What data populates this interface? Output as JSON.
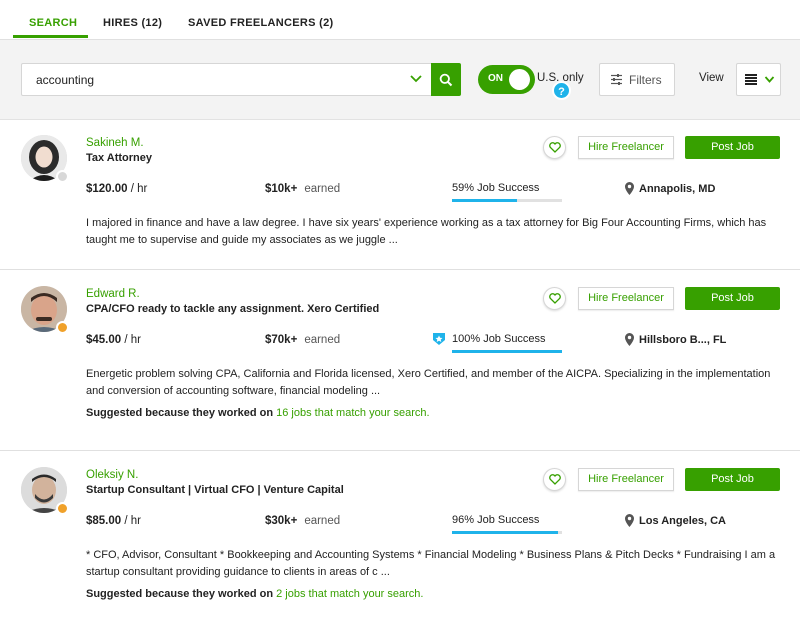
{
  "tabs": [
    {
      "label": "SEARCH",
      "active": true
    },
    {
      "label": "HIRES (12)",
      "active": false
    },
    {
      "label": "SAVED FREELANCERS (2)",
      "active": false
    }
  ],
  "search": {
    "value": "accounting",
    "us_toggle": "ON",
    "us_only_label": "U.S. only",
    "help_label": "?",
    "filters_label": "Filters",
    "view_label": "View"
  },
  "colors": {
    "accent_green": "#37a000",
    "job_success_blue": "#1fb3ea",
    "status_offline": "#d8d8d8",
    "status_away": "#f0a12a"
  },
  "actions": {
    "hire_label": "Hire Freelancer",
    "post_label": "Post Job"
  },
  "freelancers": [
    {
      "name": "Sakineh M.",
      "title": "Tax Attorney",
      "rate": "$120.00",
      "rate_unit": " / hr",
      "earned": "$10k+",
      "earned_label": "earned",
      "job_success": "59% Job Success",
      "job_success_pct": 59,
      "location": "Annapolis, MD",
      "description": "I majored in finance and have a law degree. I have six years' experience working as a tax attorney for Big Four Accounting Firms, which has taught me to supervise and guide my associates as we juggle ...",
      "status": "offline",
      "top_rated": false
    },
    {
      "name": "Edward R.",
      "title": "CPA/CFO ready to tackle any assignment. Xero Certified",
      "rate": "$45.00",
      "rate_unit": " / hr",
      "earned": "$70k+",
      "earned_label": "earned",
      "job_success": "100% Job Success",
      "job_success_pct": 100,
      "location": "Hillsboro B..., FL",
      "description": "Energetic problem solving CPA, California and Florida licensed, Xero Certified, and member of the AICPA. Specializing in the implementation and conversion of accounting software, financial modeling ...",
      "suggest_prefix": "Suggested because they worked on",
      "suggest_link": "16 jobs that match your search.",
      "status": "away",
      "top_rated": true
    },
    {
      "name": "Oleksiy N.",
      "title": "Startup Consultant | Virtual CFO | Venture Capital",
      "rate": "$85.00",
      "rate_unit": " / hr",
      "earned": "$30k+",
      "earned_label": "earned",
      "job_success": "96% Job Success",
      "job_success_pct": 96,
      "location": "Los Angeles, CA",
      "description": "* CFO, Advisor, Consultant * Bookkeeping and Accounting Systems * Financial Modeling * Business Plans & Pitch Decks * Fundraising I am a startup consultant providing guidance to clients in areas of c ...",
      "suggest_prefix": "Suggested because they worked on",
      "suggest_link": "2 jobs that match your search.",
      "status": "away",
      "top_rated": false
    }
  ]
}
